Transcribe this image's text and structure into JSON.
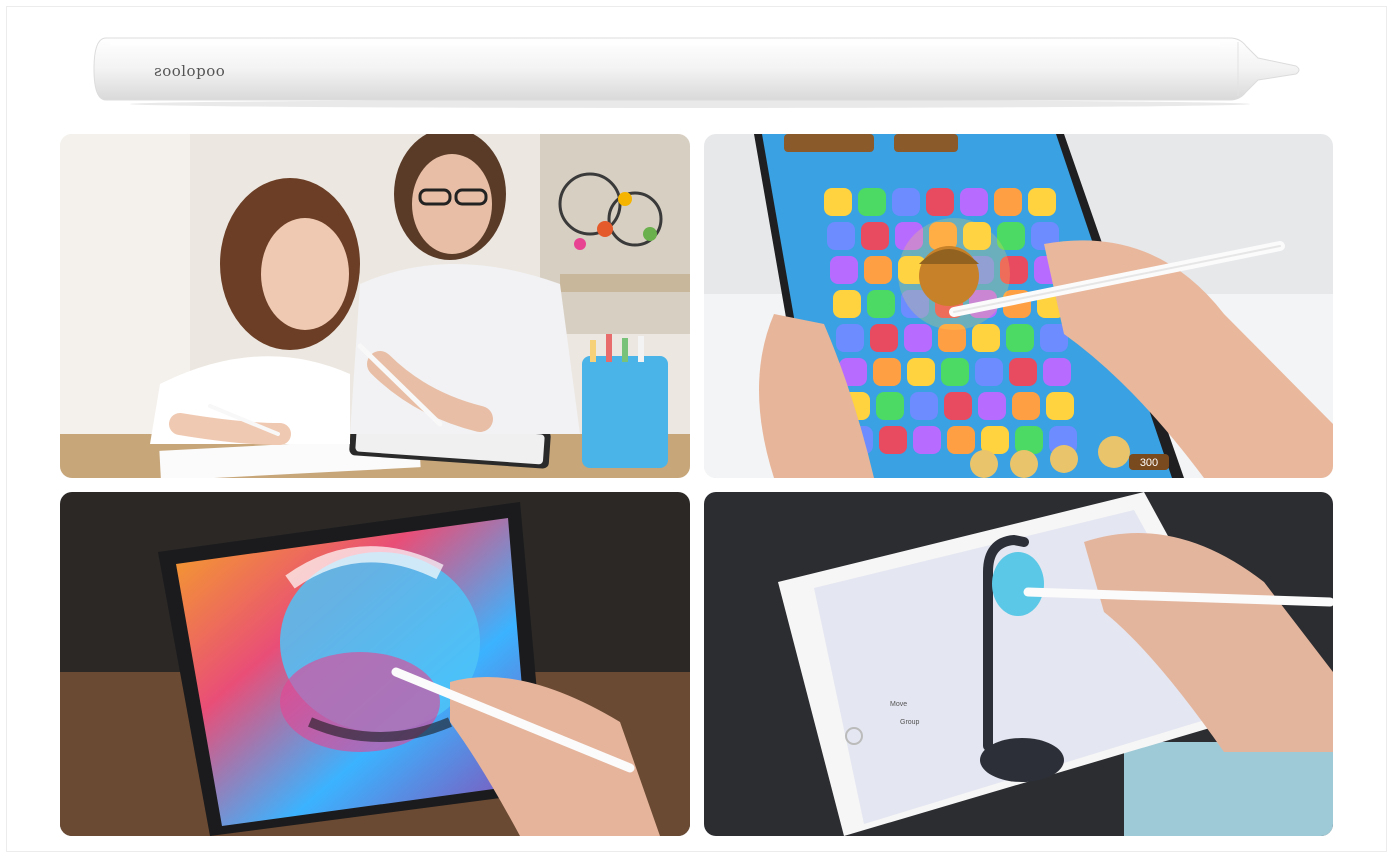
{
  "product": {
    "brand_text": "ƨoolopoo",
    "colors": {
      "pen_body": "#f4f4f4",
      "pen_shadow": "#d8d8d8"
    }
  },
  "tiles": [
    {
      "scene": "mother-and-daughter-drawing-on-tablet"
    },
    {
      "scene": "stylus-playing-match-three-game"
    },
    {
      "scene": "stylus-painting-colorful-portrait"
    },
    {
      "scene": "stylus-editing-3d-lamp-model"
    }
  ],
  "game_tile": {
    "score_badge_text": "300"
  },
  "model_tile": {
    "menu_items": [
      "Move",
      "Group"
    ]
  }
}
